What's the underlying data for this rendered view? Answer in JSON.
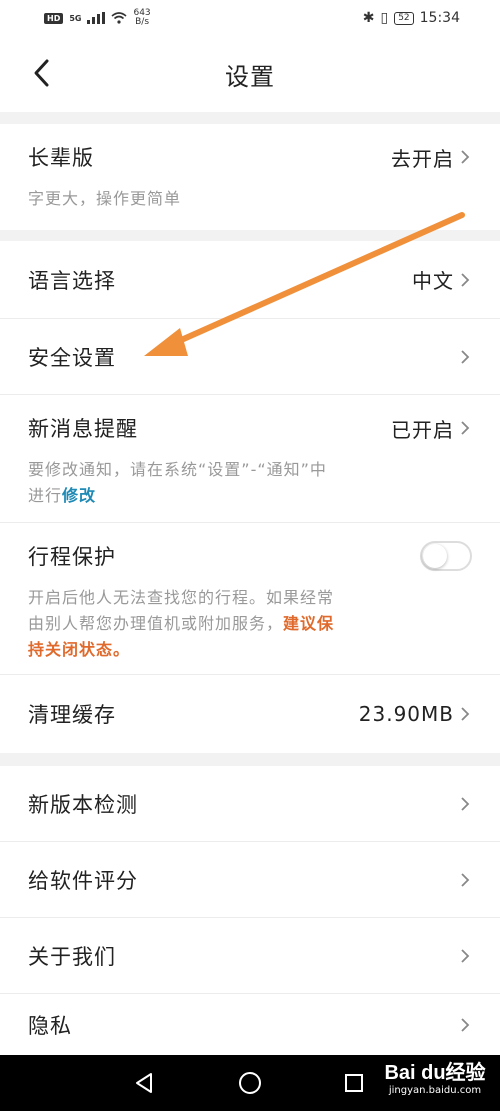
{
  "status_bar": {
    "hd": "HD",
    "signal_label": "5G",
    "speed_value": "643",
    "speed_unit": "B/s",
    "battery": "52",
    "time": "15:34"
  },
  "header": {
    "title": "设置"
  },
  "elder": {
    "label": "长辈版",
    "value": "去开启",
    "desc": "字更大，操作更简单"
  },
  "language": {
    "label": "语言选择",
    "value": "中文"
  },
  "security": {
    "label": "安全设置"
  },
  "notify": {
    "label": "新消息提醒",
    "value": "已开启",
    "desc_line1": "要修改通知，请在系统“设置”-“通知”中",
    "desc_line2_prefix": "进行",
    "desc_link": "修改"
  },
  "trip": {
    "label": "行程保护",
    "desc_line1": "开启后他人无法查找您的行程。如果经常",
    "desc_line2_prefix": "由别人帮您办理值机或附加服务，",
    "desc_warn_1": "建议保",
    "desc_warn_2": "持关闭状态。",
    "toggle_on": false
  },
  "cache": {
    "label": "清理缓存",
    "value": "23.90MB"
  },
  "more": [
    {
      "label": "新版本检测"
    },
    {
      "label": "给软件评分"
    },
    {
      "label": "关于我们"
    },
    {
      "label": "隐私"
    }
  ],
  "watermark": {
    "brand": "Bai du经验",
    "url": "jingyan.baidu.com"
  },
  "colors": {
    "link": "#1f8ab5",
    "warning": "#e06a2c",
    "annotation_arrow": "#f0903a"
  }
}
